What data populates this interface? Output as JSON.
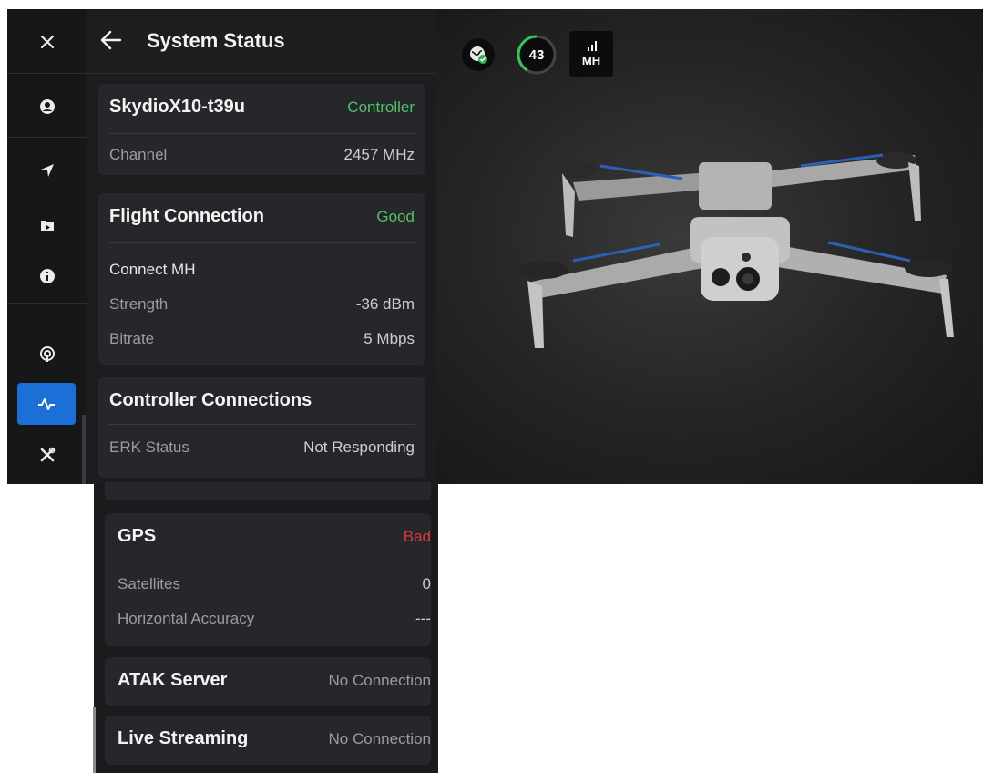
{
  "rail": {
    "items": [
      {
        "name": "close-icon"
      },
      {
        "name": "account-icon"
      },
      {
        "name": "navigation-icon"
      },
      {
        "name": "media-folder-icon"
      },
      {
        "name": "info-icon"
      },
      {
        "name": "antenna-icon"
      },
      {
        "name": "pulse-icon",
        "active": true
      },
      {
        "name": "tools-icon"
      }
    ]
  },
  "header": {
    "title": "System Status"
  },
  "vehicle": {
    "name": "SkydioX10-t39u",
    "role": "Controller",
    "channel_label": "Channel",
    "channel_value": "2457 MHz"
  },
  "flight": {
    "title": "Flight Connection",
    "status": "Good",
    "link_name": "Connect MH",
    "strength_label": "Strength",
    "strength_value": "-36 dBm",
    "bitrate_label": "Bitrate",
    "bitrate_value": "5 Mbps"
  },
  "controller": {
    "title": "Controller Connections",
    "erk_label": "ERK Status",
    "erk_value": "Not Responding"
  },
  "gps": {
    "title": "GPS",
    "status": "Bad",
    "sat_label": "Satellites",
    "sat_value": "0",
    "acc_label": "Horizontal Accuracy",
    "acc_value": "---"
  },
  "atak": {
    "title": "ATAK Server",
    "status": "No Connection"
  },
  "streaming": {
    "title": "Live Streaming",
    "status": "No Connection"
  },
  "topbar": {
    "battery": "43",
    "link_label": "MH"
  },
  "colors": {
    "accent": "#1d6fd8",
    "good": "#53c06a",
    "bad": "#d93a3a",
    "panel": "#1c1d1f",
    "card": "#26272a"
  }
}
